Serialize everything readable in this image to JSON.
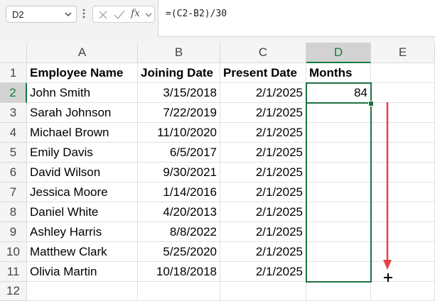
{
  "name_box": {
    "value": "D2"
  },
  "formula_bar": {
    "fx_label": "fx",
    "formula": "=(C2-B2)/30"
  },
  "columns": [
    "A",
    "B",
    "C",
    "D",
    "E"
  ],
  "rows": [
    "1",
    "2",
    "3",
    "4",
    "5",
    "6",
    "7",
    "8",
    "9",
    "10",
    "11",
    "12"
  ],
  "headers": {
    "name": "Employee Name",
    "joining": "Joining Date",
    "present": "Present Date",
    "months": "Months"
  },
  "data": [
    {
      "name": "John Smith",
      "joining": "3/15/2018",
      "present": "2/1/2025",
      "months": "84"
    },
    {
      "name": "Sarah Johnson",
      "joining": "7/22/2019",
      "present": "2/1/2025",
      "months": ""
    },
    {
      "name": "Michael Brown",
      "joining": "11/10/2020",
      "present": "2/1/2025",
      "months": ""
    },
    {
      "name": "Emily Davis",
      "joining": "6/5/2017",
      "present": "2/1/2025",
      "months": ""
    },
    {
      "name": "David Wilson",
      "joining": "9/30/2021",
      "present": "2/1/2025",
      "months": ""
    },
    {
      "name": "Jessica Moore",
      "joining": "1/14/2016",
      "present": "2/1/2025",
      "months": ""
    },
    {
      "name": "Daniel White",
      "joining": "4/20/2013",
      "present": "2/1/2025",
      "months": ""
    },
    {
      "name": "Ashley Harris",
      "joining": "8/8/2022",
      "present": "2/1/2025",
      "months": ""
    },
    {
      "name": "Matthew Clark",
      "joining": "5/25/2020",
      "present": "2/1/2025",
      "months": ""
    },
    {
      "name": "Olivia Martin",
      "joining": "10/18/2018",
      "present": "2/1/2025",
      "months": ""
    }
  ],
  "selection": {
    "active_cell": "D2",
    "range": "D2:D11"
  },
  "colors": {
    "accent": "#1e7145",
    "arrow": "#e84343",
    "header_bg": "#f5f5f5"
  },
  "icons": {
    "name_box_dropdown": "chevron-down-icon",
    "more": "vertical-dots-icon",
    "cancel": "close-icon",
    "enter": "check-icon",
    "arrow": "arrow-down-icon",
    "cursor": "crosshair-cursor-icon"
  }
}
